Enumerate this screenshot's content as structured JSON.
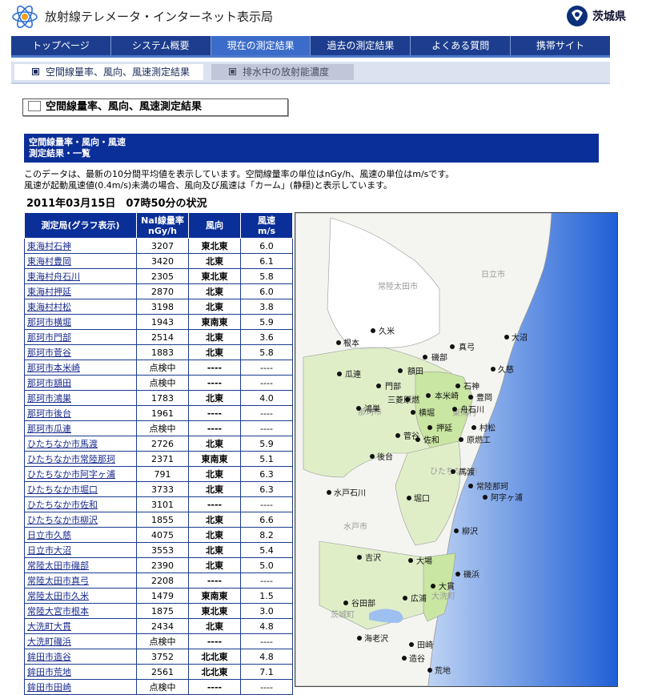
{
  "header": {
    "title": "放射線テレメータ・インターネット表示局",
    "pref_name": "茨城県"
  },
  "nav": [
    {
      "label": "トップページ"
    },
    {
      "label": "システム概要"
    },
    {
      "label": "現在の測定結果",
      "active": true
    },
    {
      "label": "過去の測定結果"
    },
    {
      "label": "よくある質問"
    },
    {
      "label": "携帯サイト"
    }
  ],
  "subnav": {
    "tab1": "空間線量率、風向、風速測定結果",
    "tab2": "排水中の放射能濃度"
  },
  "section_title": "空間線量率、風向、風速測定結果",
  "bluebox": {
    "line1": "空間線量率・風向・風速",
    "line2": "測定結果・一覧"
  },
  "desc": {
    "line1": "このデータは、最新の10分間平均値を表示しています。空間線量率の単位はnGy/h、風速の単位はm/sです。",
    "line2": "風速が起動風速値(0.4m/s)未満の場合、風向及び風速は「カーム」(静穏)と表示しています。"
  },
  "status": "2011年03月15日　07時50分の状況",
  "table": {
    "headers": {
      "station": "測定局(グラフ表示)",
      "value_1": "NaI線量率",
      "value_2": "nGy/h",
      "dir": "風向",
      "speed_1": "風速",
      "speed_2": "m/s"
    },
    "rows": [
      {
        "station": "東海村石神",
        "value": "3207",
        "dir": "東北東",
        "speed": "6.0"
      },
      {
        "station": "東海村豊岡",
        "value": "3420",
        "dir": "北東",
        "speed": "6.1"
      },
      {
        "station": "東海村舟石川",
        "value": "2305",
        "dir": "東北東",
        "speed": "5.8"
      },
      {
        "station": "東海村押延",
        "value": "2870",
        "dir": "北東",
        "speed": "6.0"
      },
      {
        "station": "東海村村松",
        "value": "3198",
        "dir": "北東",
        "speed": "3.8"
      },
      {
        "station": "那珂市横堀",
        "value": "1943",
        "dir": "東南東",
        "speed": "5.9"
      },
      {
        "station": "那珂市門部",
        "value": "2514",
        "dir": "北東",
        "speed": "3.6"
      },
      {
        "station": "那珂市菅谷",
        "value": "1883",
        "dir": "北東",
        "speed": "5.8"
      },
      {
        "station": "那珂市本米崎",
        "value": "点検中",
        "dir": "----",
        "speed": "----"
      },
      {
        "station": "那珂市額田",
        "value": "点検中",
        "dir": "----",
        "speed": "----"
      },
      {
        "station": "那珂市鴻巣",
        "value": "1783",
        "dir": "北東",
        "speed": "4.0"
      },
      {
        "station": "那珂市後台",
        "value": "1961",
        "dir": "----",
        "speed": "----"
      },
      {
        "station": "那珂市瓜連",
        "value": "点検中",
        "dir": "----",
        "speed": "----"
      },
      {
        "station": "ひたちなか市馬渡",
        "value": "2726",
        "dir": "北東",
        "speed": "5.9"
      },
      {
        "station": "ひたちなか市常陸那珂",
        "value": "2371",
        "dir": "東南東",
        "speed": "5.1"
      },
      {
        "station": "ひたちなか市阿字ヶ浦",
        "value": "791",
        "dir": "北東",
        "speed": "6.3"
      },
      {
        "station": "ひたちなか市堀口",
        "value": "3733",
        "dir": "北東",
        "speed": "6.3"
      },
      {
        "station": "ひたちなか市佐和",
        "value": "3101",
        "dir": "----",
        "speed": "----"
      },
      {
        "station": "ひたちなか市柳沢",
        "value": "1855",
        "dir": "北東",
        "speed": "6.6"
      },
      {
        "station": "日立市久慈",
        "value": "4075",
        "dir": "北東",
        "speed": "8.2"
      },
      {
        "station": "日立市大沼",
        "value": "3553",
        "dir": "北東",
        "speed": "5.4"
      },
      {
        "station": "常陸太田市磯部",
        "value": "2390",
        "dir": "北東",
        "speed": "5.0"
      },
      {
        "station": "常陸太田市真弓",
        "value": "2208",
        "dir": "----",
        "speed": "----"
      },
      {
        "station": "常陸太田市久米",
        "value": "1479",
        "dir": "東南東",
        "speed": "1.5"
      },
      {
        "station": "常陸大宮市根本",
        "value": "1875",
        "dir": "東北東",
        "speed": "3.0"
      },
      {
        "station": "大洗町大貫",
        "value": "2434",
        "dir": "北東",
        "speed": "4.8"
      },
      {
        "station": "大洗町磯浜",
        "value": "点検中",
        "dir": "----",
        "speed": "----"
      },
      {
        "station": "鉾田市造谷",
        "value": "3752",
        "dir": "北北東",
        "speed": "4.8"
      },
      {
        "station": "鉾田市荒地",
        "value": "2561",
        "dir": "北北東",
        "speed": "7.1"
      },
      {
        "station": "鉾田市田崎",
        "value": "点検中",
        "dir": "----",
        "speed": "----"
      }
    ]
  },
  "map": {
    "areas": [
      "常陸太田市",
      "日立市",
      "那珂市",
      "東海村",
      "ひたちなか市",
      "水戸市",
      "茨城町",
      "大洗町"
    ],
    "stations": [
      "久米",
      "根本",
      "大沼",
      "真弓",
      "磯部",
      "久慈",
      "額田",
      "瓜連",
      "石神",
      "門部",
      "本米崎",
      "豊岡",
      "三菱原燃",
      "横堀",
      "舟石川",
      "鴻巣",
      "押延",
      "村松",
      "菅谷",
      "佐和",
      "原燃工",
      "後台",
      "馬渡",
      "常陸那珂",
      "水戸石川",
      "堀口",
      "阿字ヶ浦",
      "柳沢",
      "吉沢",
      "大場",
      "磯浜",
      "大貫",
      "谷田部",
      "広浦",
      "海老沢",
      "田崎",
      "造谷",
      "荒地"
    ]
  }
}
